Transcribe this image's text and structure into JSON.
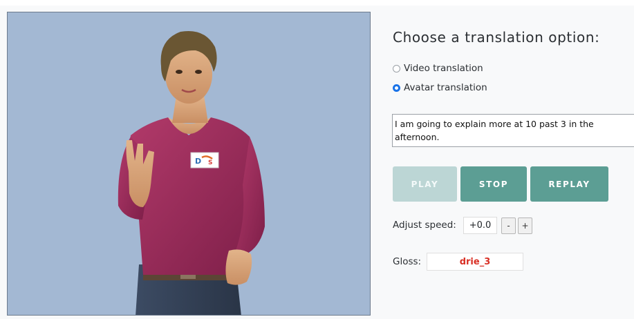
{
  "panel": {
    "heading": "Choose a translation option:",
    "options": [
      {
        "label": "Video translation",
        "selected": false
      },
      {
        "label": "Avatar translation",
        "selected": true
      }
    ],
    "input_text": "I am going to explain more at 10 past 3 in the afternoon.",
    "buttons": {
      "play": "PLAY",
      "stop": "STOP",
      "replay": "REPLAY"
    },
    "speed": {
      "label": "Adjust speed:",
      "value": "+0.0",
      "minus": "-",
      "plus": "+"
    },
    "gloss": {
      "label": "Gloss:",
      "value": "drie_3"
    }
  },
  "colors": {
    "stage_background": "#a3b8d3",
    "button_teal": "#5c9e94",
    "button_disabled": "#bcd6d5",
    "gloss_text": "#d93025",
    "radio_selected": "#1a73e8"
  }
}
